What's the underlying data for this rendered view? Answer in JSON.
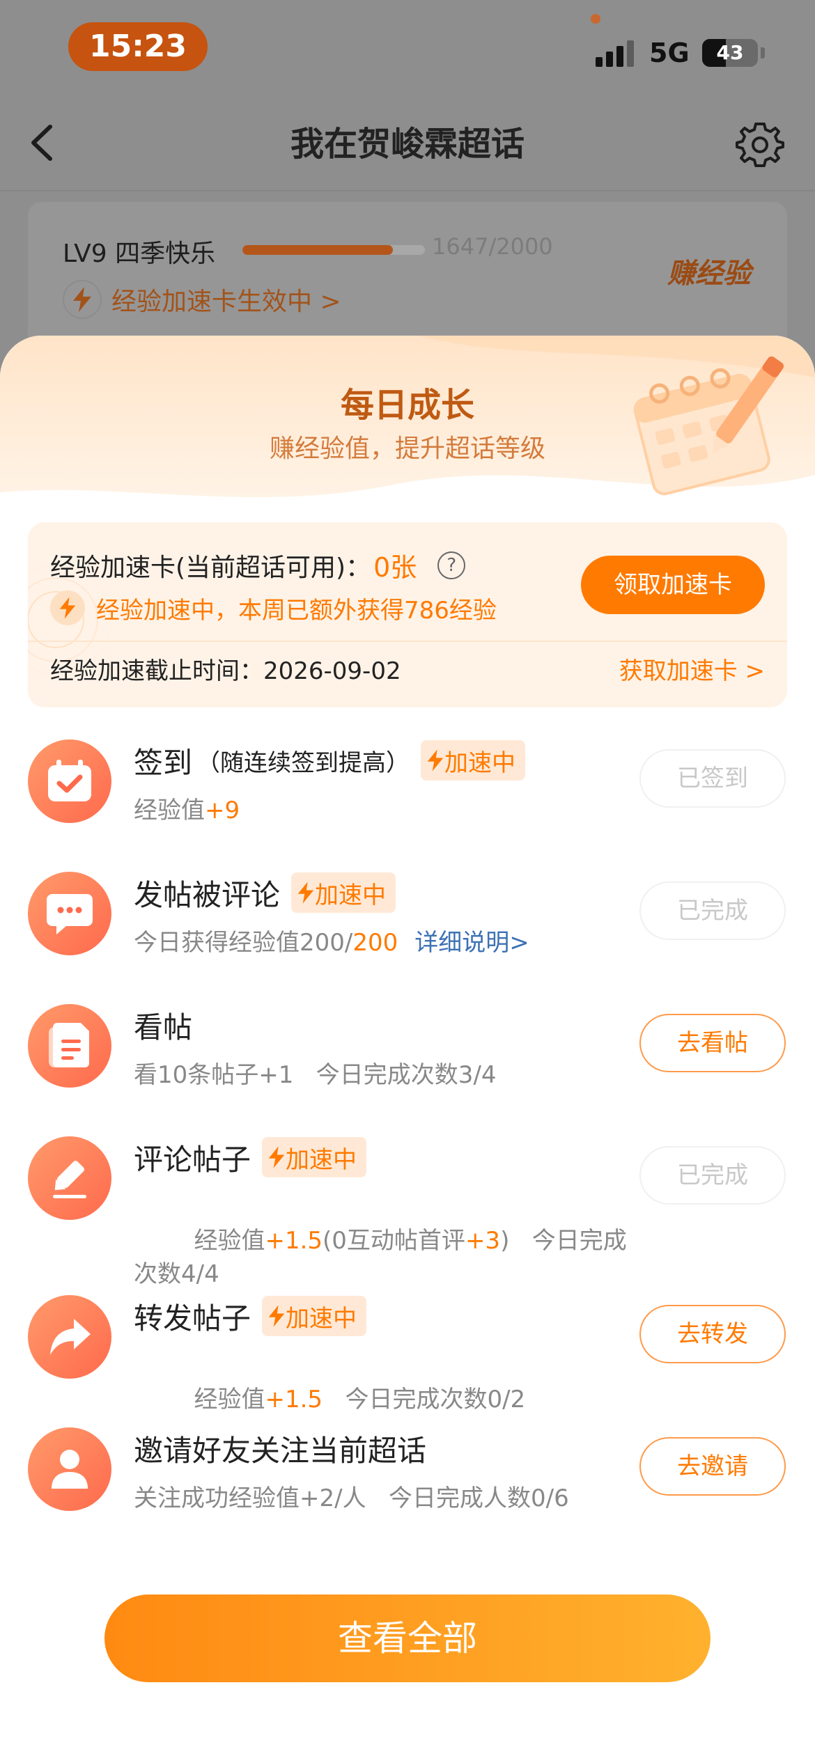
{
  "status_bar": {
    "time": "15:23",
    "network": "5G",
    "battery": "43",
    "battery_level": 0.43
  },
  "nav": {
    "title": "我在贺峻霖超话",
    "back_icon": "chevron-left-icon",
    "settings_icon": "gear-icon"
  },
  "level_card": {
    "level_label": "LV9 四季快乐",
    "progress_text": "1647/2000",
    "progress_value": 1647,
    "progress_max": 2000,
    "boost_status": "经验加速卡生效中 >",
    "earn_label": "赚经验"
  },
  "sheet": {
    "title": "每日成长",
    "subtitle": "赚经验值，提升超话等级"
  },
  "boost_card": {
    "title": "经验加速卡(当前超话可用)：",
    "count": "0张",
    "help": "?",
    "boost_text": "经验加速中，本周已额外获得786经验",
    "claim_button": "领取加速卡",
    "deadline": "经验加速截止时间：2026-09-02",
    "get_link": "获取加速卡 >"
  },
  "boost_tag_label": "加速中",
  "tasks": [
    {
      "name": "签到",
      "note": "（随连续签到提高）",
      "boost": true,
      "desc_prefix": "经验值",
      "desc_hl": "+9",
      "button": "已签到",
      "button_state": "done",
      "icon": "calendar-check-icon"
    },
    {
      "name": "发帖被评论",
      "boost": true,
      "desc_prefix": "今日获得经验值200/",
      "desc_hl": "200",
      "desc_link": "详细说明>",
      "button": "已完成",
      "button_state": "done",
      "icon": "chat-bubble-icon"
    },
    {
      "name": "看帖",
      "boost": false,
      "desc": "看10条帖子+1   今日完成次数3/4",
      "button": "去看帖",
      "button_state": "active",
      "icon": "document-icon"
    },
    {
      "name": "评论帖子",
      "boost": true,
      "desc_a": "经验值",
      "desc_hl1": "+1.5",
      "desc_b": "(0互动帖首评",
      "desc_hl2": "+3",
      "desc_c": ")   今日完成次数4/4",
      "button": "已完成",
      "button_state": "done",
      "icon": "pencil-icon"
    },
    {
      "name": "转发帖子",
      "boost": true,
      "desc_prefix": "经验值",
      "desc_hl": "+1.5",
      "desc_suffix": "   今日完成次数0/2",
      "button": "去转发",
      "button_state": "active",
      "icon": "share-arrow-icon"
    },
    {
      "name": "邀请好友关注当前超话",
      "boost": false,
      "desc": "关注成功经验值+2/人   今日完成人数0/6",
      "button": "去邀请",
      "button_state": "active",
      "icon": "user-icon"
    }
  ],
  "view_all_button": "查看全部",
  "colors": {
    "accent": "#ff7a00",
    "title_brown": "#bf5a12",
    "link_blue": "#3d72b4"
  }
}
